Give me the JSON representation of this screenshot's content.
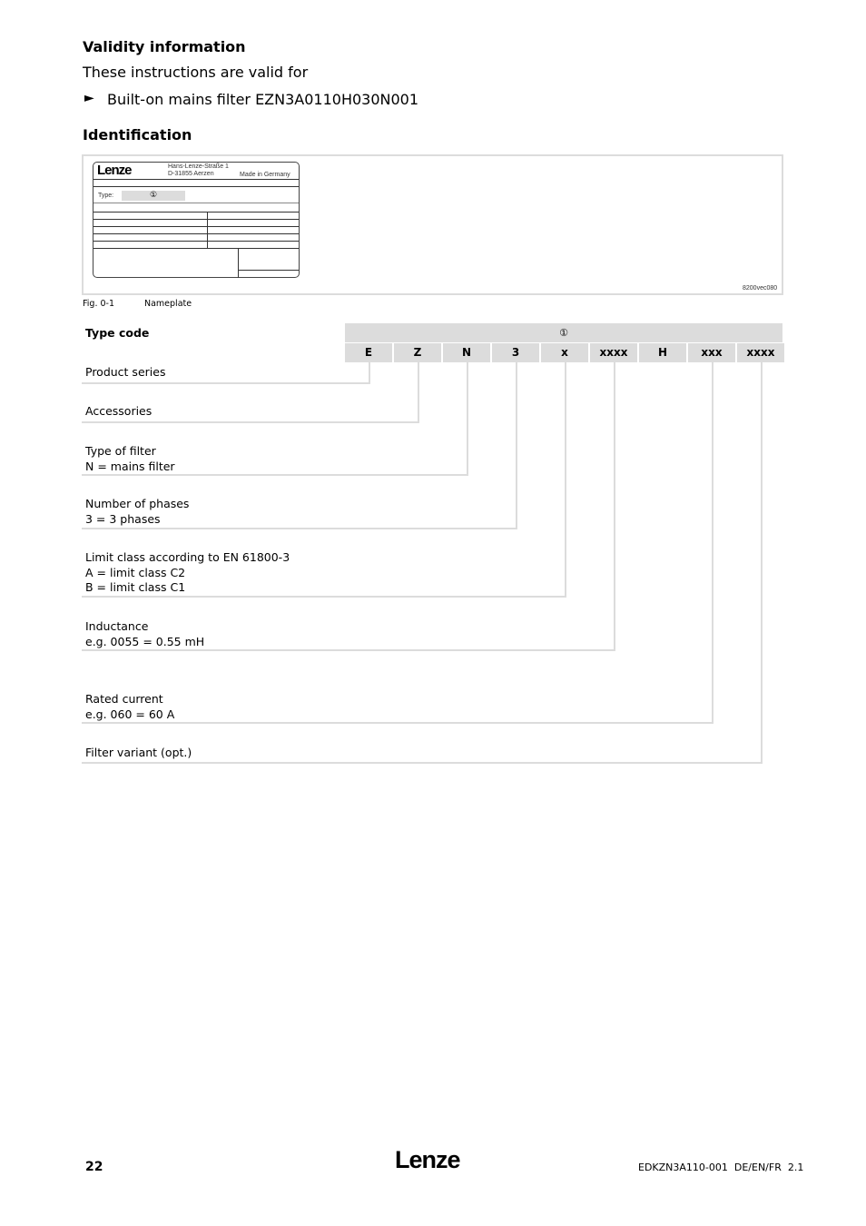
{
  "validity": {
    "heading": "Validity information",
    "intro": "These instructions are valid for",
    "bullet_icon": "triangle-right-icon",
    "bullet_glyph": "►",
    "item": "Built-on mains filter EZN3A0110H030N001"
  },
  "identification": {
    "heading": "Identification",
    "nameplate": {
      "logo": "Lenze",
      "address_line1": "Hans-Lenze-Straße 1",
      "address_line2": "D-31855 Aerzen",
      "made_in": "Made in Germany",
      "type_label": "Type:",
      "marker": "①"
    },
    "figure_code": "8200vec080",
    "figure_number": "Fig. 0-1",
    "figure_caption": "Nameplate"
  },
  "type_code": {
    "heading": "Type code",
    "marker": "①",
    "segments": [
      "E",
      "Z",
      "N",
      "3",
      "x",
      "xxxx",
      "H",
      "xxx",
      "xxxx"
    ],
    "descriptions": [
      {
        "lines": [
          "Product series"
        ]
      },
      {
        "lines": [
          "Accessories"
        ]
      },
      {
        "lines": [
          "Type of filter",
          "N = mains filter"
        ]
      },
      {
        "lines": [
          "Number of phases",
          "3 = 3 phases"
        ]
      },
      {
        "lines": [
          "Limit class according to EN 61800-3",
          "A = limit class C2",
          "B = limit class C1"
        ]
      },
      {
        "lines": [
          "Inductance",
          "e.g. 0055 = 0.55 mH"
        ]
      },
      {
        "lines": [
          "Rated current",
          "e.g. 060 = 60 A"
        ]
      },
      {
        "lines": [
          "Filter variant (opt.)"
        ]
      }
    ]
  },
  "footer": {
    "page_number": "22",
    "logo": "Lenze",
    "doc_id": "EDKZN3A110-001  DE/EN/FR  2.1"
  }
}
